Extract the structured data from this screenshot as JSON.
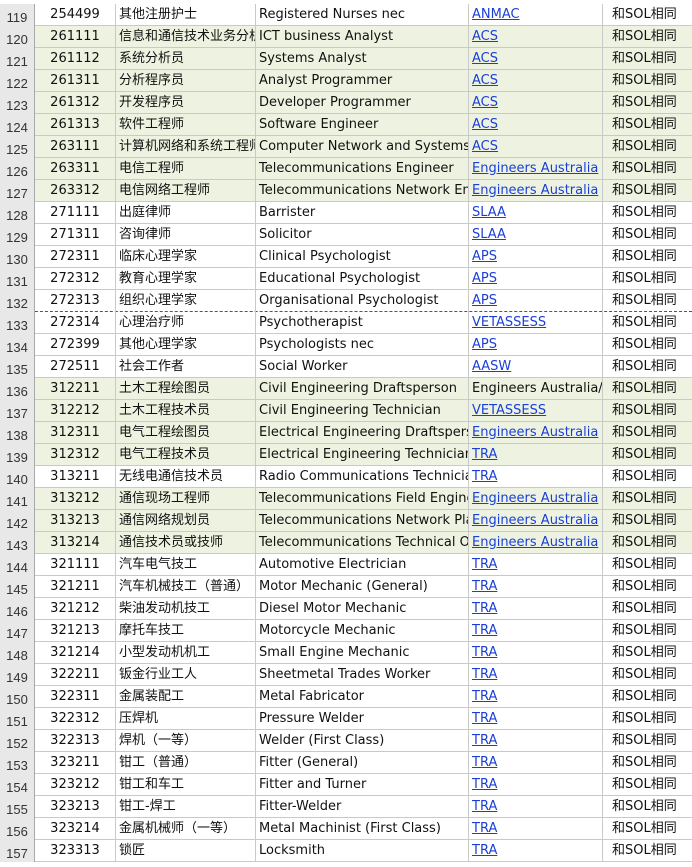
{
  "sheet": {
    "rows": [
      {
        "n": "119",
        "code": "254499",
        "cn": "其他注册护士",
        "en": "Registered Nurses nec",
        "body": "ANMAC",
        "link": true,
        "sol": "和SOL相同",
        "green": false,
        "dash": false
      },
      {
        "n": "120",
        "code": "261111",
        "cn": "信息和通信技术业务分析",
        "en": "ICT business Analyst",
        "body": "ACS",
        "link": true,
        "sol": "和SOL相同",
        "green": true,
        "dash": false
      },
      {
        "n": "121",
        "code": "261112",
        "cn": "系统分析员",
        "en": "Systems Analyst",
        "body": "ACS",
        "link": true,
        "sol": "和SOL相同",
        "green": true,
        "dash": false
      },
      {
        "n": "122",
        "code": "261311",
        "cn": "分析程序员",
        "en": "Analyst Programmer",
        "body": "ACS",
        "link": true,
        "sol": "和SOL相同",
        "green": true,
        "dash": false
      },
      {
        "n": "123",
        "code": "261312",
        "cn": "开发程序员",
        "en": "Developer Programmer",
        "body": "ACS",
        "link": true,
        "sol": "和SOL相同",
        "green": true,
        "dash": false
      },
      {
        "n": "124",
        "code": "261313",
        "cn": "软件工程师",
        "en": "Software Engineer",
        "body": "ACS",
        "link": true,
        "sol": "和SOL相同",
        "green": true,
        "dash": false
      },
      {
        "n": "125",
        "code": "263111",
        "cn": "计算机网络和系统工程师",
        "en": "Computer Network and Systems Engineer",
        "body": "ACS",
        "link": true,
        "sol": "和SOL相同",
        "green": true,
        "dash": false
      },
      {
        "n": "126",
        "code": "263311",
        "cn": "电信工程师",
        "en": "Telecommunications Engineer",
        "body": "Engineers Australia",
        "link": true,
        "sol": "和SOL相同",
        "green": true,
        "dash": false
      },
      {
        "n": "127",
        "code": "263312",
        "cn": "电信网络工程师",
        "en": "Telecommunications Network Engineer",
        "body": "Engineers Australia",
        "link": true,
        "sol": "和SOL相同",
        "green": true,
        "dash": false
      },
      {
        "n": "128",
        "code": "271111",
        "cn": "出庭律师",
        "en": "Barrister",
        "body": "SLAA",
        "link": true,
        "sol": "和SOL相同",
        "green": false,
        "dash": false
      },
      {
        "n": "129",
        "code": "271311",
        "cn": "咨询律师",
        "en": "Solicitor",
        "body": "SLAA",
        "link": true,
        "sol": "和SOL相同",
        "green": false,
        "dash": false
      },
      {
        "n": "130",
        "code": "272311",
        "cn": "临床心理学家",
        "en": "Clinical Psychologist",
        "body": "APS",
        "link": true,
        "sol": "和SOL相同",
        "green": false,
        "dash": false
      },
      {
        "n": "131",
        "code": "272312",
        "cn": "教育心理学家",
        "en": "Educational Psychologist",
        "body": "APS",
        "link": true,
        "sol": "和SOL相同",
        "green": false,
        "dash": false
      },
      {
        "n": "132",
        "code": "272313",
        "cn": "组织心理学家",
        "en": "Organisational Psychologist",
        "body": "APS",
        "link": true,
        "sol": "和SOL相同",
        "green": false,
        "dash": true
      },
      {
        "n": "133",
        "code": "272314",
        "cn": "心理治疗师",
        "en": "Psychotherapist",
        "body": "VETASSESS",
        "link": true,
        "sol": "和SOL相同",
        "green": false,
        "dash": false
      },
      {
        "n": "134",
        "code": "272399",
        "cn": "其他心理学家",
        "en": "Psychologists nec",
        "body": "APS",
        "link": true,
        "sol": "和SOL相同",
        "green": false,
        "dash": false
      },
      {
        "n": "135",
        "code": "272511",
        "cn": "社会工作者",
        "en": "Social Worker",
        "body": "AASW",
        "link": true,
        "sol": "和SOL相同",
        "green": false,
        "dash": false
      },
      {
        "n": "136",
        "code": "312211",
        "cn": "土木工程绘图员",
        "en": "Civil Engineering Draftsperson",
        "body": "Engineers Australia/ VETASSESS",
        "link": false,
        "sol": "和SOL相同",
        "green": true,
        "dash": false
      },
      {
        "n": "137",
        "code": "312212",
        "cn": "土木工程技术员",
        "en": "Civil Engineering Technician",
        "body": "VETASSESS",
        "link": true,
        "sol": "和SOL相同",
        "green": true,
        "dash": false
      },
      {
        "n": "138",
        "code": "312311",
        "cn": "电气工程绘图员",
        "en": "Electrical Engineering Draftsperson",
        "body": "Engineers Australia",
        "link": true,
        "sol": "和SOL相同",
        "green": true,
        "dash": false
      },
      {
        "n": "139",
        "code": "312312",
        "cn": "电气工程技术员",
        "en": "Electrical Engineering Technician",
        "body": "TRA",
        "link": true,
        "sol": "和SOL相同",
        "green": true,
        "dash": false
      },
      {
        "n": "140",
        "code": "313211",
        "cn": "无线电通信技术员",
        "en": "Radio Communications Technician",
        "body": "TRA",
        "link": true,
        "sol": "和SOL相同",
        "green": false,
        "dash": false
      },
      {
        "n": "141",
        "code": "313212",
        "cn": "通信现场工程师",
        "en": "Telecommunications Field Engineer",
        "body": "Engineers Australia",
        "link": true,
        "sol": "和SOL相同",
        "green": true,
        "dash": false
      },
      {
        "n": "142",
        "code": "313213",
        "cn": "通信网络规划员",
        "en": "Telecommunications Network Planner",
        "body": "Engineers Australia",
        "link": true,
        "sol": "和SOL相同",
        "green": true,
        "dash": false
      },
      {
        "n": "143",
        "code": "313214",
        "cn": "通信技术员或技师",
        "en": "Telecommunications Technical Officer",
        "body": "Engineers Australia",
        "link": true,
        "sol": "和SOL相同",
        "green": true,
        "dash": false
      },
      {
        "n": "144",
        "code": "321111",
        "cn": "汽车电气技工",
        "en": "Automotive Electrician",
        "body": "TRA",
        "link": true,
        "sol": "和SOL相同",
        "green": false,
        "dash": false
      },
      {
        "n": "145",
        "code": "321211",
        "cn": "汽车机械技工（普通）",
        "en": "Motor Mechanic (General)",
        "body": "TRA",
        "link": true,
        "sol": "和SOL相同",
        "green": false,
        "dash": false
      },
      {
        "n": "146",
        "code": "321212",
        "cn": "柴油发动机技工",
        "en": "Diesel Motor Mechanic",
        "body": "TRA",
        "link": true,
        "sol": "和SOL相同",
        "green": false,
        "dash": false
      },
      {
        "n": "147",
        "code": "321213",
        "cn": "摩托车技工",
        "en": "Motorcycle Mechanic",
        "body": "TRA",
        "link": true,
        "sol": "和SOL相同",
        "green": false,
        "dash": false
      },
      {
        "n": "148",
        "code": "321214",
        "cn": "小型发动机机工",
        "en": "Small Engine Mechanic",
        "body": "TRA",
        "link": true,
        "sol": "和SOL相同",
        "green": false,
        "dash": false
      },
      {
        "n": "149",
        "code": "322211",
        "cn": "钣金行业工人",
        "en": "Sheetmetal Trades Worker",
        "body": "TRA",
        "link": true,
        "sol": "和SOL相同",
        "green": false,
        "dash": false
      },
      {
        "n": "150",
        "code": "322311",
        "cn": "金属装配工",
        "en": "Metal Fabricator",
        "body": "TRA",
        "link": true,
        "sol": "和SOL相同",
        "green": false,
        "dash": false
      },
      {
        "n": "151",
        "code": "322312",
        "cn": "压焊机",
        "en": "Pressure Welder",
        "body": "TRA",
        "link": true,
        "sol": "和SOL相同",
        "green": false,
        "dash": false
      },
      {
        "n": "152",
        "code": "322313",
        "cn": "焊机（一等）",
        "en": "Welder (First Class)",
        "body": "TRA",
        "link": true,
        "sol": "和SOL相同",
        "green": false,
        "dash": false
      },
      {
        "n": "153",
        "code": "323211",
        "cn": "钳工（普通）",
        "en": "Fitter (General)",
        "body": "TRA",
        "link": true,
        "sol": "和SOL相同",
        "green": false,
        "dash": false
      },
      {
        "n": "154",
        "code": "323212",
        "cn": "钳工和车工",
        "en": "Fitter and Turner",
        "body": "TRA",
        "link": true,
        "sol": "和SOL相同",
        "green": false,
        "dash": false
      },
      {
        "n": "155",
        "code": "323213",
        "cn": "钳工-焊工",
        "en": "Fitter-Welder",
        "body": "TRA",
        "link": true,
        "sol": "和SOL相同",
        "green": false,
        "dash": false
      },
      {
        "n": "156",
        "code": "323214",
        "cn": "金属机械师（一等）",
        "en": "Metal Machinist (First Class)",
        "body": "TRA",
        "link": true,
        "sol": "和SOL相同",
        "green": false,
        "dash": false
      },
      {
        "n": "157",
        "code": "323313",
        "cn": "锁匠",
        "en": "Locksmith",
        "body": "TRA",
        "link": true,
        "sol": "和SOL相同",
        "green": false,
        "dash": false
      }
    ]
  }
}
